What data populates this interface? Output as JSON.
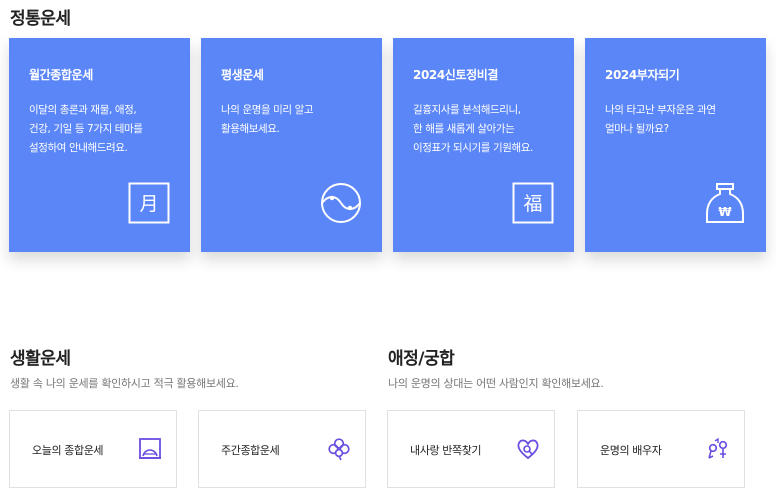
{
  "traditional": {
    "title": "정통운세",
    "cards": [
      {
        "title": "월간종합운세",
        "desc": "이달의 총론과 재물, 애정,\n건강, 기일 등 7가지 테마를\n설정하여 안내해드려요.",
        "icon": "month-char-icon",
        "glyph": "月"
      },
      {
        "title": "평생운세",
        "desc": "나의 운명을 미리 알고\n활용해보세요.",
        "icon": "yin-yang-icon"
      },
      {
        "title": "2024신토정비결",
        "desc": "길흉지사를 분석해드리니,\n한 해를 새롭게 살아가는\n이정표가 되시기를 기원해요.",
        "icon": "fortune-char-icon",
        "glyph": "福"
      },
      {
        "title": "2024부자되기",
        "desc": "나의 타고난 부자운은 과연\n얼마나 될까요?",
        "icon": "money-bag-icon",
        "glyph": "₩"
      }
    ]
  },
  "life": {
    "title": "생활운세",
    "subtitle": "생활 속 나의 운세를 확인하시고 적극 활용해보세요.",
    "tiles": [
      {
        "label": "오늘의 종합운세",
        "icon": "sunrise-frame-icon"
      },
      {
        "label": "주간종합운세",
        "icon": "clover-icon"
      }
    ]
  },
  "love": {
    "title": "애정/궁합",
    "subtitle": "나의 운명의 상대는 어떤 사람인지 확인해보세요.",
    "tiles": [
      {
        "label": "내사랑 반쪽찾기",
        "icon": "heart-search-icon"
      },
      {
        "label": "운명의 배우자",
        "icon": "gender-symbols-icon"
      }
    ]
  },
  "colors": {
    "card_bg": "#5b86f7",
    "icon_accent": "#6b4de0",
    "tile_border": "#e1e1e1"
  }
}
